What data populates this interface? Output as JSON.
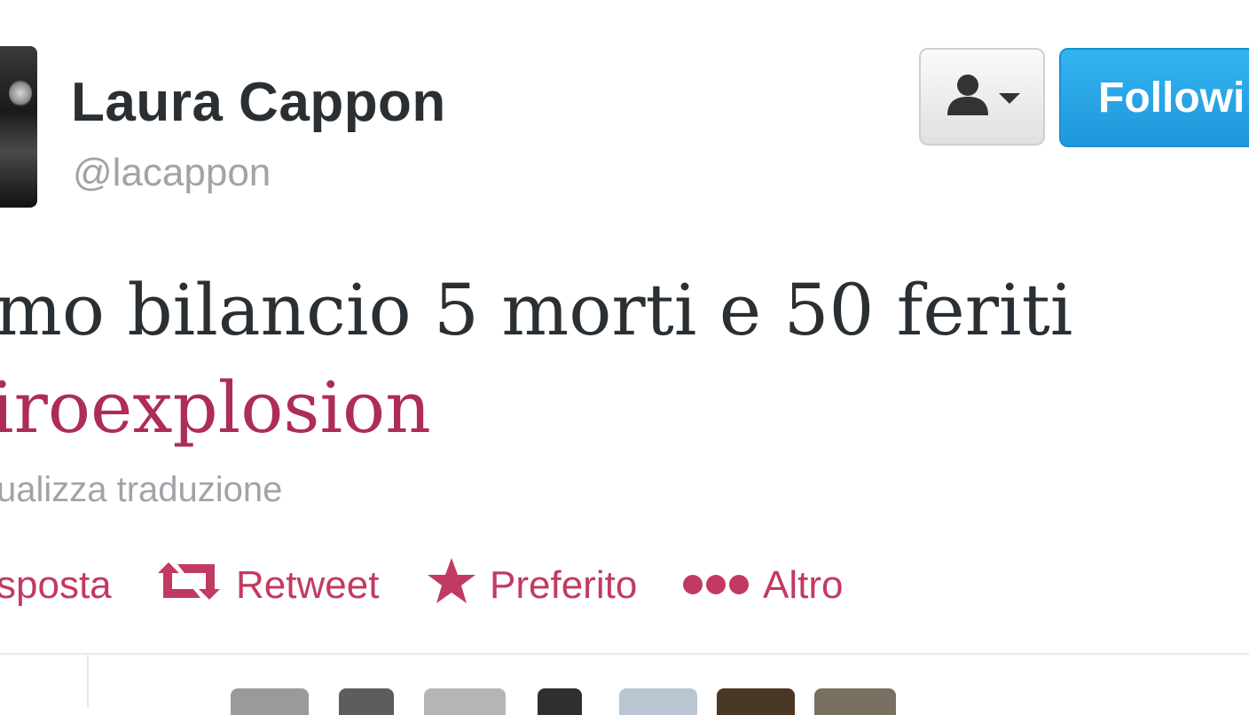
{
  "profile": {
    "display_name": "Laura Cappon",
    "handle": "@lacappon"
  },
  "buttons": {
    "follow_label": "Followi"
  },
  "tweet": {
    "text_line1": "mo bilancio 5 morti e 50 feriti",
    "hashtag": "iroexplosion",
    "translate_label": "ualizza traduzione"
  },
  "actions": {
    "reply_label": "sposta",
    "retweet_label": "Retweet",
    "favorite_label": "Preferito",
    "more_label": "Altro"
  },
  "icons": {
    "user_dropdown": "person-icon",
    "retweet": "retweet-icon",
    "favorite": "star-icon",
    "more": "ellipsis-icon"
  },
  "colors": {
    "accent": "#c23a61",
    "follow_blue": "#2aa7e8",
    "text": "#292f33",
    "muted": "#a0a4a8"
  }
}
